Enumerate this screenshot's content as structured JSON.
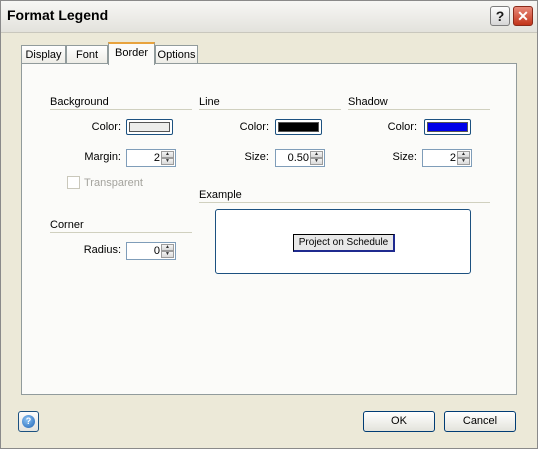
{
  "window": {
    "title": "Format Legend"
  },
  "titlebar": {
    "help_glyph": "?",
    "close_glyph": "✕"
  },
  "tabs": [
    {
      "label": "Display",
      "active": false
    },
    {
      "label": "Font",
      "active": false
    },
    {
      "label": "Border",
      "active": true
    },
    {
      "label": "Options",
      "active": false
    }
  ],
  "background": {
    "title": "Background",
    "color_label": "Color:",
    "color": "#ededeb",
    "margin_label": "Margin:",
    "margin_value": "2",
    "transparent_label": "Transparent",
    "transparent_checked": false
  },
  "corner": {
    "title": "Corner",
    "radius_label": "Radius:",
    "radius_value": "0"
  },
  "line": {
    "title": "Line",
    "color_label": "Color:",
    "color": "#000000",
    "size_label": "Size:",
    "size_value": "0.50"
  },
  "shadow": {
    "title": "Shadow",
    "color_label": "Color:",
    "color": "#0000e8",
    "size_label": "Size:",
    "size_value": "2"
  },
  "example": {
    "title": "Example",
    "label_text": "Project on Schedule"
  },
  "footer": {
    "ok_label": "OK",
    "cancel_label": "Cancel",
    "help_glyph": "?"
  }
}
